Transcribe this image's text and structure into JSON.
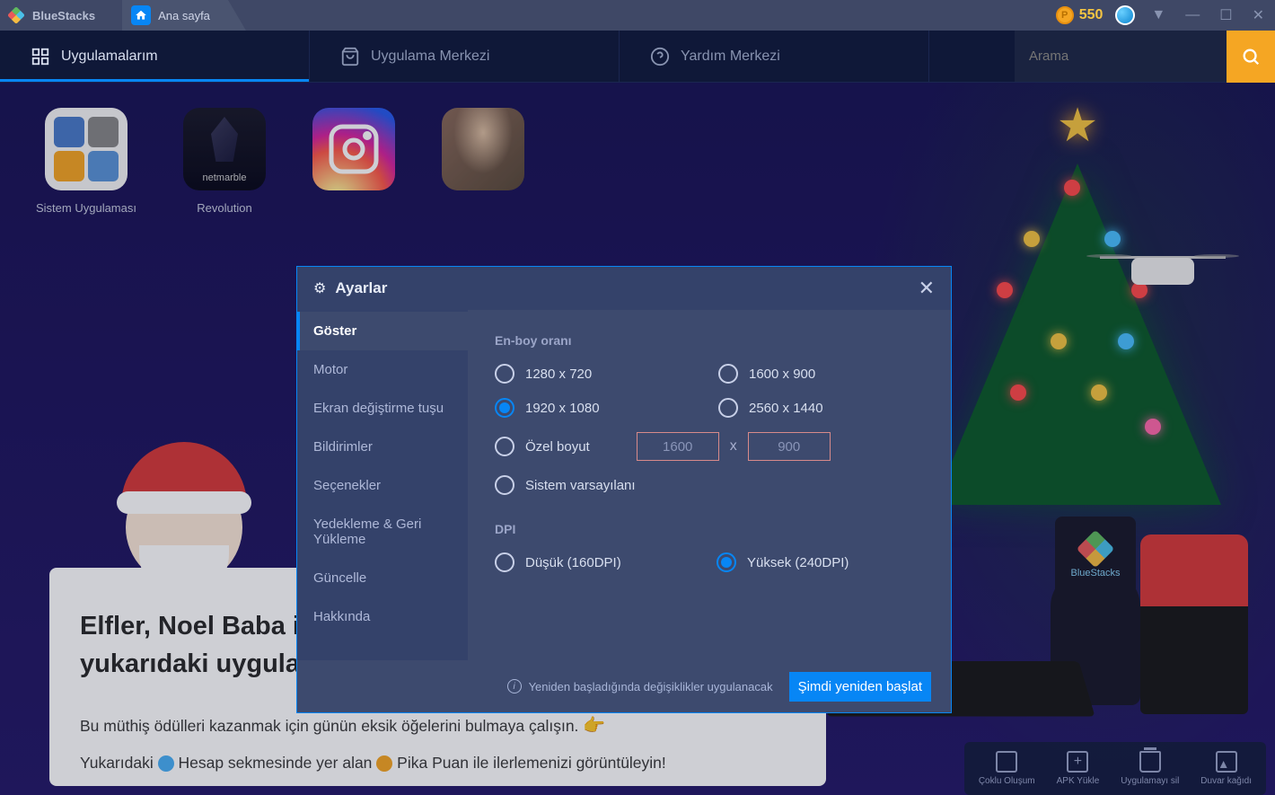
{
  "titlebar": {
    "brand": "BlueStacks",
    "tab_home": "Ana sayfa",
    "points": "550"
  },
  "navbar": {
    "my_apps": "Uygulamalarım",
    "app_center": "Uygulama Merkezi",
    "help_center": "Yardım Merkezi",
    "search_placeholder": "Arama"
  },
  "apps": [
    {
      "name": "Sistem Uygulaması"
    },
    {
      "name": "Revolution"
    },
    {
      "name": ""
    },
    {
      "name": ""
    }
  ],
  "promo": {
    "title": "Elfler, Noel Baba için hediyeleri sardı! BlueStacks'taki yukarıdaki uygulamalarda gizlenmiş olanları bul",
    "line1": "Bu müthiş ödülleri kazanmak için günün eksik öğelerini bulmaya çalışın.",
    "line2_a": "Yukarıdaki",
    "line2_b": "Hesap sekmesinde yer alan",
    "line2_c": "Pika Puan ile ilerlemenizi görüntüleyin!"
  },
  "settings": {
    "title": "Ayarlar",
    "sidebar": [
      "Göster",
      "Motor",
      "Ekran değiştirme tuşu",
      "Bildirimler",
      "Seçenekler",
      "Yedekleme & Geri Yükleme",
      "Güncelle",
      "Hakkında"
    ],
    "section_aspect": "En-boy oranı",
    "res_1280": "1280 x 720",
    "res_1600": "1600 x 900",
    "res_1920": "1920 x 1080",
    "res_2560": "2560 x 1440",
    "custom_size": "Özel boyut",
    "custom_w": "1600",
    "custom_h": "900",
    "x_sep": "x",
    "system_default": "Sistem varsayılanı",
    "section_dpi": "DPI",
    "dpi_low": "Düşük (160DPI)",
    "dpi_high": "Yüksek (240DPI)",
    "footer_info": "Yeniden başladığında değişiklikler uygulanacak",
    "restart": "Şimdi yeniden başlat"
  },
  "bottom_toolbar": {
    "multi": "Çoklu Oluşum",
    "apk": "APK Yükle",
    "delete": "Uygulamayı sil",
    "wallpaper": "Duvar kağıdı"
  },
  "bs_card": "BlueStacks"
}
